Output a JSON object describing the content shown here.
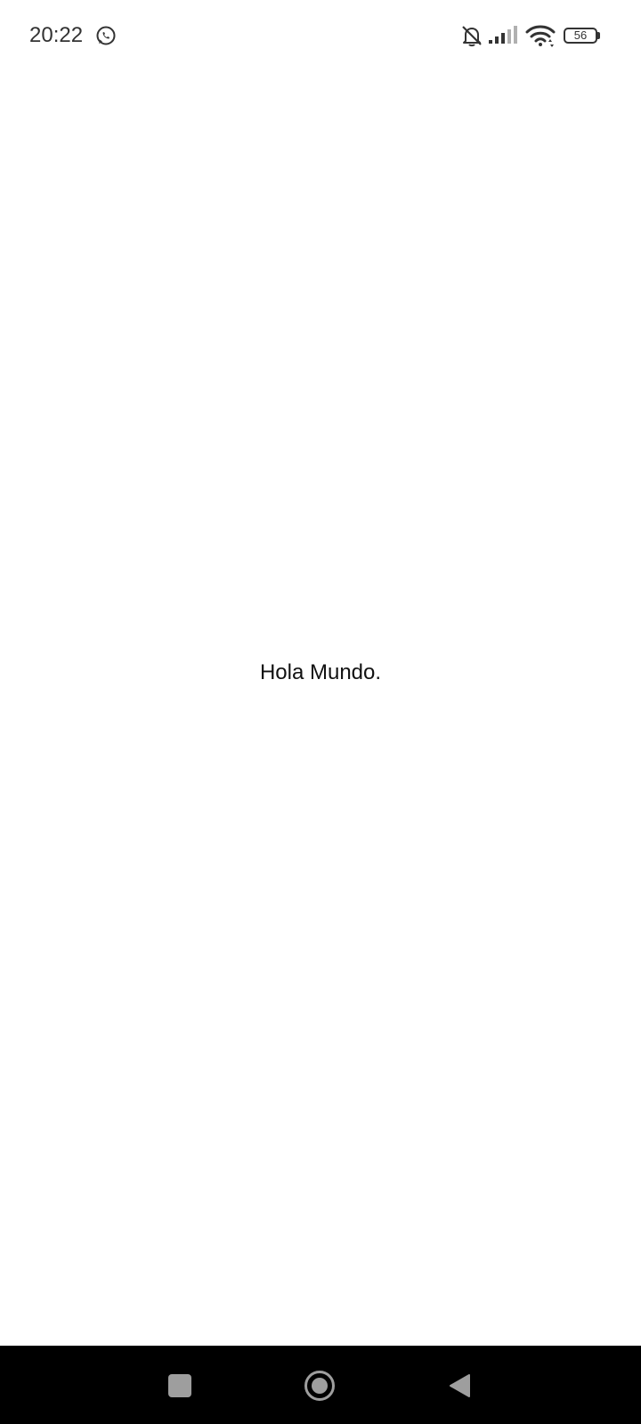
{
  "status_bar": {
    "time": "20:22",
    "battery_level": "56",
    "icons": {
      "notification": "whatsapp-icon",
      "bell": "bell-off-icon",
      "signal": "signal-icon",
      "wifi": "wifi-icon"
    }
  },
  "main": {
    "text": "Hola Mundo."
  },
  "nav_bar": {
    "icons": [
      "recents-button",
      "home-button",
      "back-button"
    ]
  },
  "colors": {
    "background": "#ffffff",
    "status_text": "#333333",
    "nav_background": "#000000",
    "nav_icon": "#9e9e9e"
  }
}
